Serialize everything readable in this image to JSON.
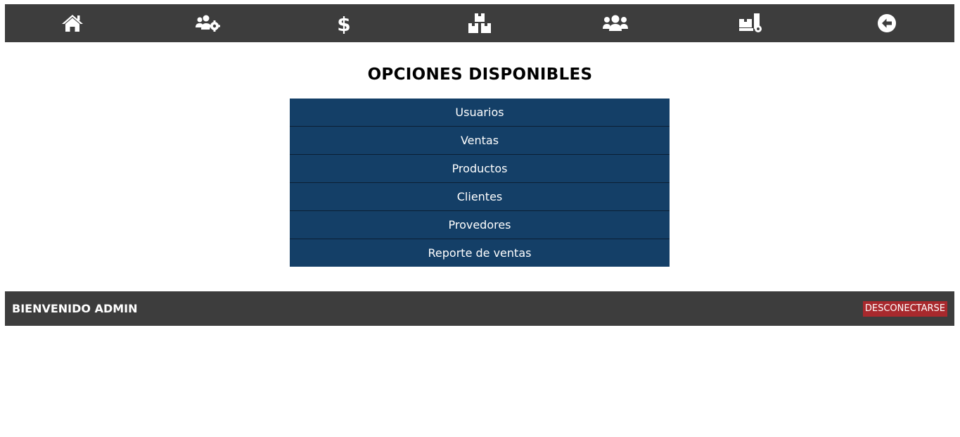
{
  "nav": {
    "items": [
      {
        "icon": "home-icon"
      },
      {
        "icon": "users-gear-icon"
      },
      {
        "icon": "dollar-icon"
      },
      {
        "icon": "boxes-icon"
      },
      {
        "icon": "users-icon"
      },
      {
        "icon": "dolly-icon"
      },
      {
        "icon": "arrow-circle-left-icon"
      }
    ],
    "background": "#3d3d3d"
  },
  "main": {
    "title": "OPCIONES DISPONIBLES",
    "options": [
      {
        "label": "Usuarios"
      },
      {
        "label": "Ventas"
      },
      {
        "label": "Productos"
      },
      {
        "label": "Clientes"
      },
      {
        "label": "Provedores"
      },
      {
        "label": "Reporte de ventas"
      }
    ],
    "option_color": "#143f67"
  },
  "footer": {
    "welcome": "BIENVENIDO ADMIN",
    "logout_label": "DESCONECTARSE",
    "logout_color": "#a8292d"
  }
}
